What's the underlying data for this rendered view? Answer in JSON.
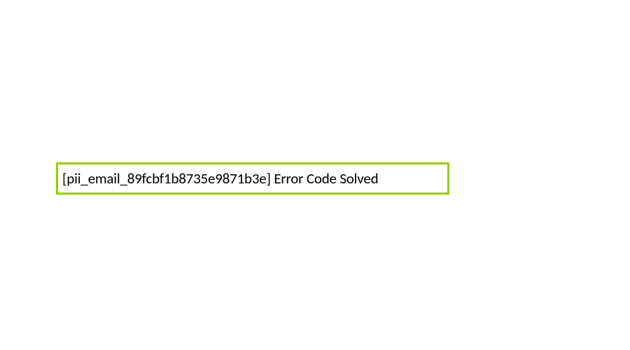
{
  "error": {
    "message": "[pii_email_89fcbf1b8735e9871b3e] Error Code Solved"
  }
}
